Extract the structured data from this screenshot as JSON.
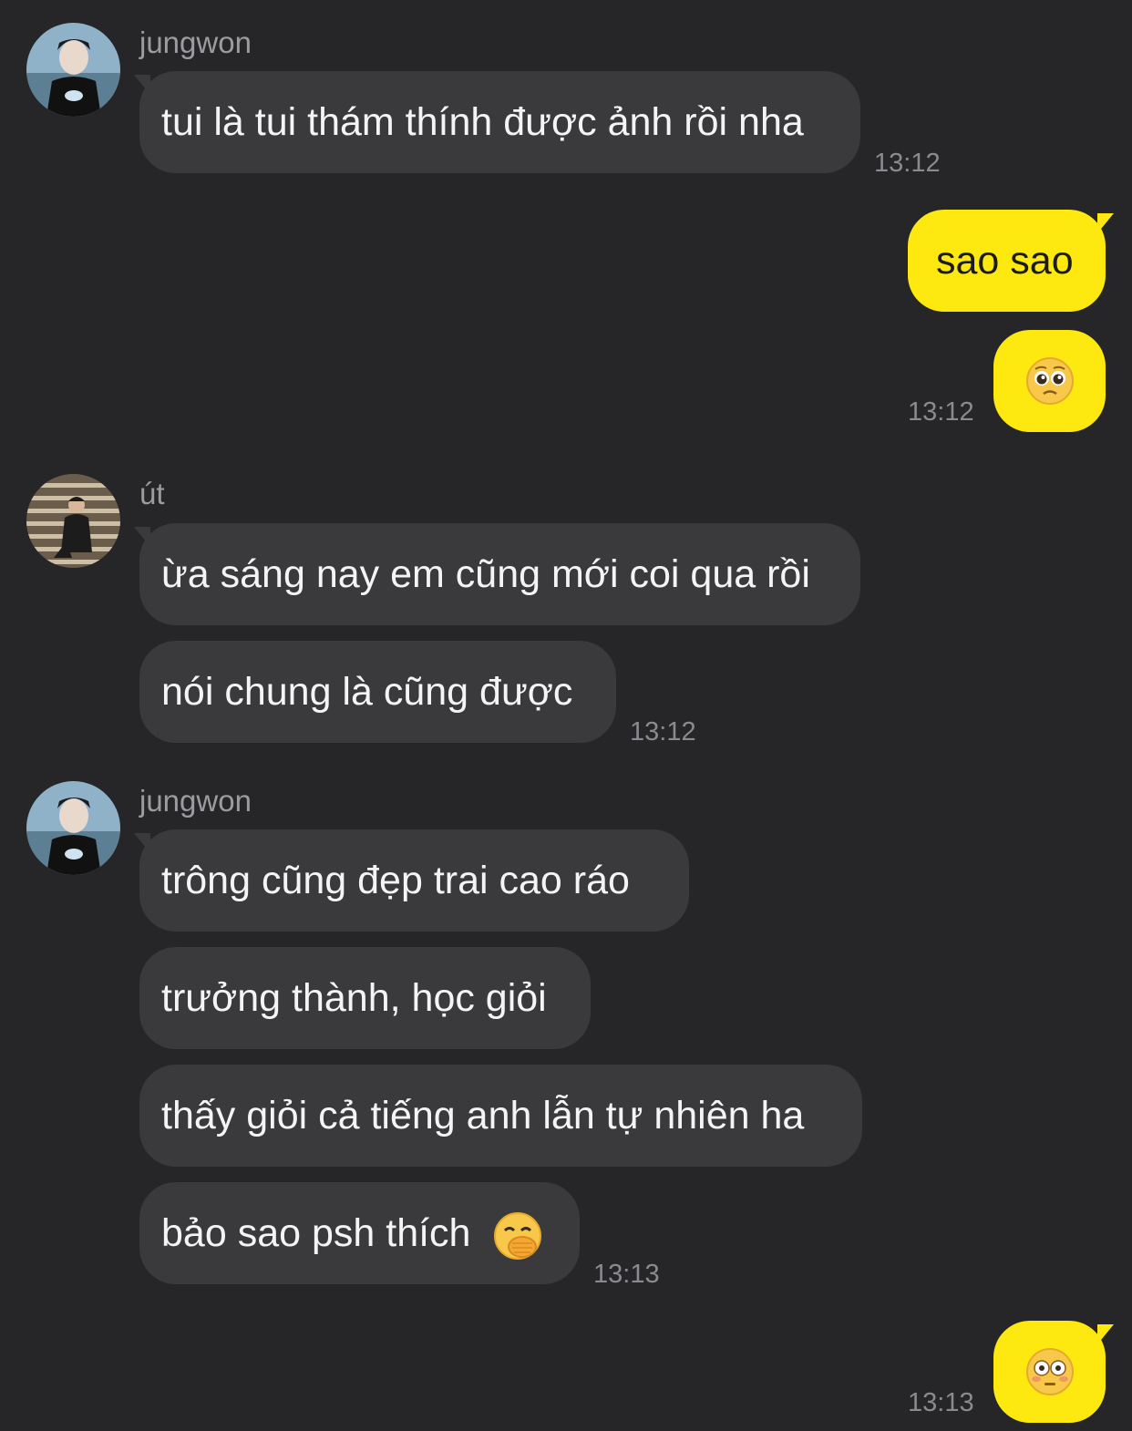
{
  "messages": [
    {
      "sender": "jungwon",
      "text": "tui là tui thám thính được ảnh rồi nha",
      "time": "13:12"
    },
    {
      "sender": "me",
      "text": "sao sao"
    },
    {
      "sender": "me",
      "emoji": "pleading-face-emoji",
      "time": "13:12"
    },
    {
      "sender": "út",
      "text": "ừa sáng nay em cũng mới coi qua rồi"
    },
    {
      "sender": "út",
      "text": "nói chung là cũng được",
      "time": "13:12"
    },
    {
      "sender": "jungwon",
      "text": "trông cũng đẹp trai cao ráo"
    },
    {
      "sender": "jungwon",
      "text": "trưởng thành, học giỏi"
    },
    {
      "sender": "jungwon",
      "text": "thấy giỏi cả tiếng anh lẫn tự nhiên ha"
    },
    {
      "sender": "jungwon",
      "text": "bảo sao psh thích",
      "emoji": "face-with-hand-over-mouth-emoji",
      "time": "13:13"
    },
    {
      "sender": "me",
      "emoji": "flushed-face-emoji",
      "time": "13:13"
    }
  ],
  "colors": {
    "background": "#262628",
    "incoming_bubble": "#3a3a3d",
    "outgoing_bubble": "#fde910",
    "timestamp": "#8a8a8f",
    "sender_name": "#9b9ba0"
  }
}
